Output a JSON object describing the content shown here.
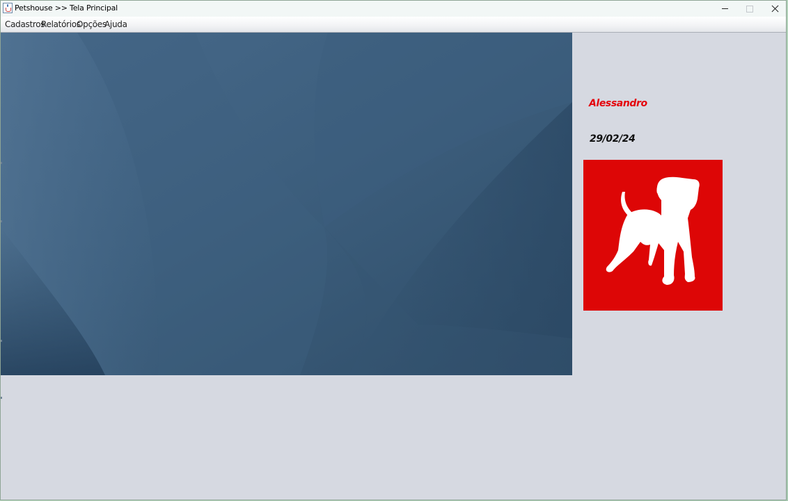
{
  "window": {
    "title": "Petshouse >> Tela Principal",
    "icon": "java-cup-icon",
    "controls": {
      "minimize": "minimize-icon",
      "maximize": "maximize-icon",
      "close": "close-icon"
    }
  },
  "menubar": {
    "items": [
      {
        "label": "Cadastros"
      },
      {
        "label": "Relatórios"
      },
      {
        "label": "Opções"
      },
      {
        "label": "Ajuda"
      }
    ]
  },
  "panel": {
    "user_name": "Alessandro",
    "date": "29/02/24",
    "logo": "dog-silhouette-logo"
  },
  "colors": {
    "panel_background": "#d6d9e1",
    "user_name": "#e4040c",
    "logo_background": "#dd0606",
    "desktop_background": "#3a5a78"
  }
}
